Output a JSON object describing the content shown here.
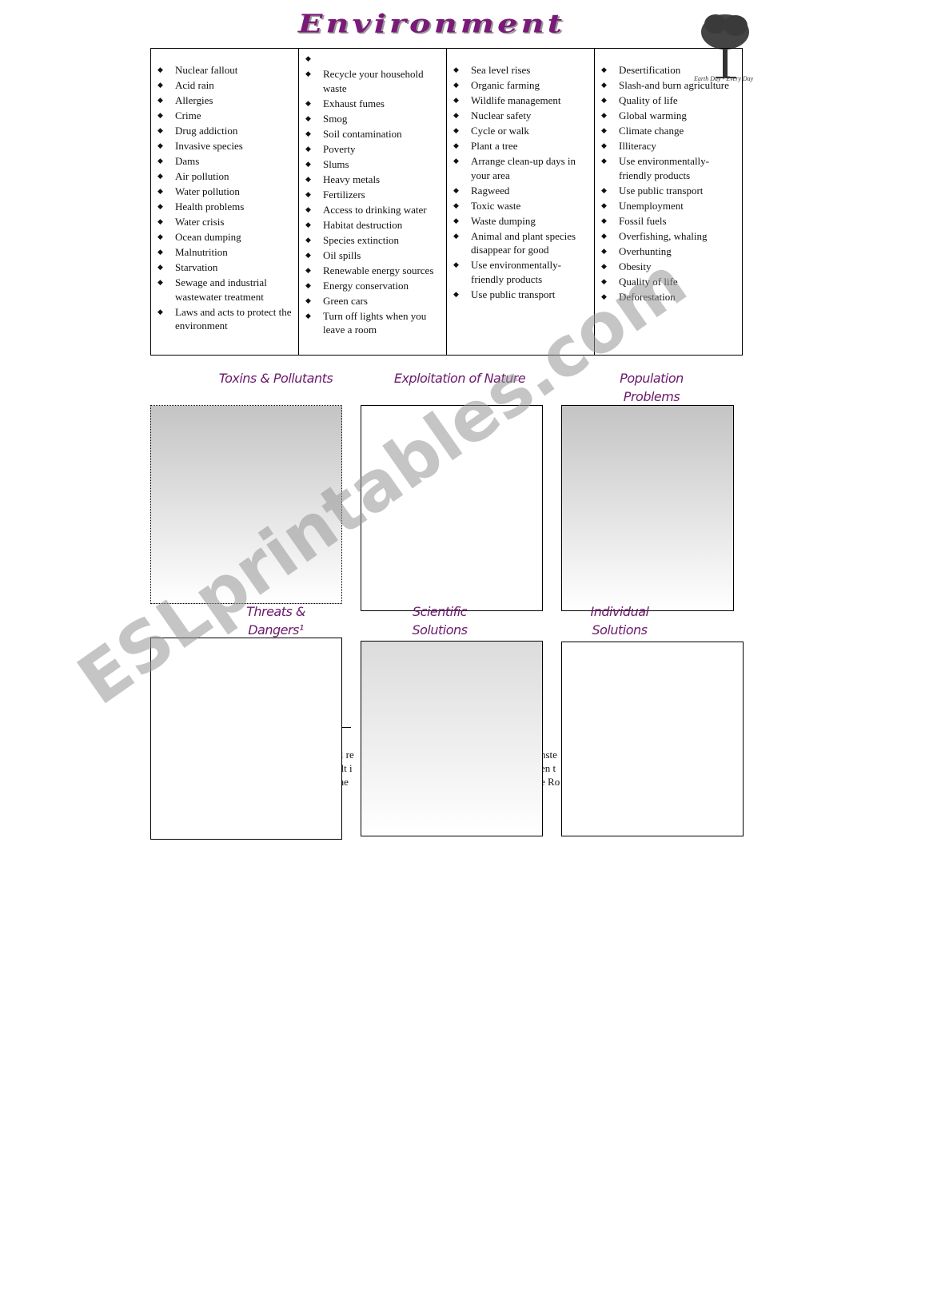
{
  "title": "Environment",
  "logo_caption": "Earth Day - Every Day",
  "columns": [
    [
      "Nuclear fallout",
      "Acid rain",
      "Allergies",
      "Crime",
      "Drug addiction",
      "Invasive species",
      "Dams",
      "Air pollution",
      "Water pollution",
      "Health problems",
      "Water crisis",
      "Ocean dumping",
      "Malnutrition",
      "Starvation",
      "Sewage and industrial wastewater treatment",
      "Laws and acts to protect the environment"
    ],
    [
      "",
      "Recycle your household waste",
      "Exhaust fumes",
      "Smog",
      "Soil contamination",
      "Poverty",
      "Slums",
      "Heavy metals",
      "Fertilizers",
      "Access to drinking water",
      "Habitat destruction",
      "Species extinction",
      "Oil spills",
      "Renewable energy sources",
      "Energy conservation",
      "Green cars",
      "Turn off lights when you leave a room"
    ],
    [
      "Sea level rises",
      "Organic farming",
      "Wildlife management",
      "Nuclear safety",
      "Cycle or walk",
      "Plant a tree",
      "Arrange clean-up days in your area",
      "Ragweed",
      "Toxic waste",
      "Waste dumping",
      "Animal and plant species disappear for good",
      "Use environmentally-friendly products",
      "Use public transport"
    ],
    [
      "Desertification",
      "Slash-and burn agriculture",
      "Quality of life",
      "Global warming",
      "Climate change",
      "Illiteracy",
      "Use environmentally-friendly products",
      "Use public transport",
      "Unemployment",
      "Fossil fuels",
      "Overfishing, whaling",
      "Overhunting",
      "Obesity",
      "Quality of life",
      "Deforestation"
    ]
  ],
  "categories": [
    "Toxins & Pollutants",
    "Exploitation of Nature",
    "Population Problems",
    "Threats & Dangers¹",
    "Scientific Solutions",
    "Individual Solutions"
  ],
  "fragments_left": [
    "al re",
    "ult i",
    "the"
  ],
  "fragments_right": [
    "nste",
    "en t",
    "e Ro"
  ],
  "watermark": "ESLprintables.com"
}
